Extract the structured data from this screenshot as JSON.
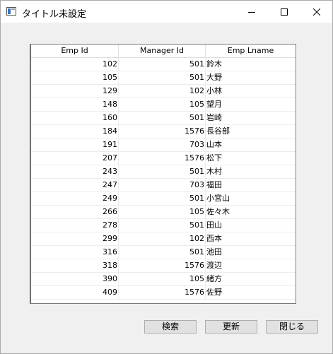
{
  "window": {
    "title": "タイトル未設定"
  },
  "grid": {
    "columns": [
      "Emp Id",
      "Manager Id",
      "Emp Lname"
    ],
    "rows": [
      [
        "102",
        "501",
        "鈴木"
      ],
      [
        "105",
        "501",
        "大野"
      ],
      [
        "129",
        "102",
        "小林"
      ],
      [
        "148",
        "105",
        "望月"
      ],
      [
        "160",
        "501",
        "岩崎"
      ],
      [
        "184",
        "1576",
        "長谷部"
      ],
      [
        "191",
        "703",
        "山本"
      ],
      [
        "207",
        "1576",
        "松下"
      ],
      [
        "243",
        "501",
        "木村"
      ],
      [
        "247",
        "703",
        "福田"
      ],
      [
        "249",
        "501",
        "小宮山"
      ],
      [
        "266",
        "105",
        "佐々木"
      ],
      [
        "278",
        "501",
        "田山"
      ],
      [
        "299",
        "102",
        "西本"
      ],
      [
        "316",
        "501",
        "池田"
      ],
      [
        "318",
        "1576",
        "渡辺"
      ],
      [
        "390",
        "105",
        "緒方"
      ],
      [
        "409",
        "1576",
        "佐野"
      ]
    ]
  },
  "buttons": {
    "search": "検索",
    "refresh": "更新",
    "close": "閉じる"
  }
}
